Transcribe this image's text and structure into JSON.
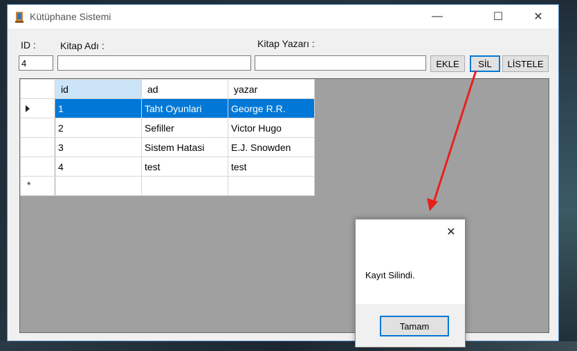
{
  "window": {
    "title": "Kütüphane Sistemi",
    "controls": {
      "minimize": "—",
      "maximize": "☐",
      "close": "✕"
    }
  },
  "form": {
    "id_label": "ID :",
    "id_value": "4",
    "book_label": "Kitap Adı :",
    "book_value": "",
    "author_label": "Kitap Yazarı :",
    "author_value": "",
    "buttons": {
      "add": "EKLE",
      "delete": "SİL",
      "list": "LİSTELE"
    }
  },
  "grid": {
    "columns": [
      "id",
      "ad",
      "yazar"
    ],
    "rows": [
      {
        "id": "1",
        "ad": "Taht Oyunlari",
        "yazar": "George R.R.",
        "selected": true
      },
      {
        "id": "2",
        "ad": "Sefiller",
        "yazar": "Victor Hugo"
      },
      {
        "id": "3",
        "ad": "Sistem Hatasi",
        "yazar": "E.J. Snowden"
      },
      {
        "id": "4",
        "ad": "test",
        "yazar": "test"
      }
    ],
    "new_row_marker": "*"
  },
  "dialog": {
    "message": "Kayıt Silindi.",
    "ok_label": "Tamam",
    "close_glyph": "✕"
  },
  "colors": {
    "selection": "#0078d7",
    "annotation_arrow": "#e8201a"
  },
  "icons": [
    "app-icon",
    "close-icon",
    "maximize-icon",
    "minimize-icon",
    "row-pointer-icon",
    "new-row-icon"
  ]
}
